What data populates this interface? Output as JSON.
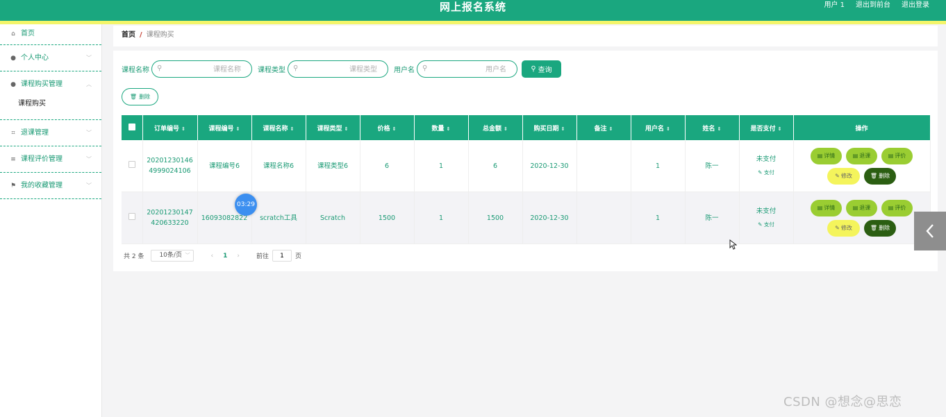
{
  "header": {
    "title": "网上报名系统",
    "links": [
      "用户 1",
      "退出到前台",
      "退出登录"
    ]
  },
  "sidebar": {
    "items": [
      {
        "label": "首页",
        "icon": "home-icon"
      },
      {
        "label": "个人中心",
        "icon": "user-icon"
      },
      {
        "label": "课程购买管理",
        "icon": "user-icon",
        "expanded": true
      },
      {
        "label": "课程购买",
        "sub": true
      },
      {
        "label": "退课管理",
        "icon": "crop-icon"
      },
      {
        "label": "课程评价管理",
        "icon": "list-icon"
      },
      {
        "label": "我的收藏管理",
        "icon": "flag-icon"
      }
    ]
  },
  "breadcrumb": {
    "home": "首页",
    "separator": "/",
    "current": "课程购买"
  },
  "filters": {
    "course_name": {
      "label": "课程名称",
      "placeholder": "课程名称"
    },
    "course_type": {
      "label": "课程类型",
      "placeholder": "课程类型"
    },
    "username": {
      "label": "用户名",
      "placeholder": "用户名"
    },
    "query_label": "查询",
    "batch_delete_label": "删除"
  },
  "table": {
    "columns": [
      "订单编号",
      "课程编号",
      "课程名称",
      "课程类型",
      "价格",
      "数量",
      "总金额",
      "购买日期",
      "备注",
      "用户名",
      "姓名",
      "是否支付",
      "操作"
    ],
    "rows": [
      {
        "order_no": "202012301464999024106",
        "course_no": "课程编号6",
        "course_name": "课程名称6",
        "course_type": "课程类型6",
        "price": "6",
        "qty": "1",
        "total": "6",
        "date": "2020-12-30",
        "note": "",
        "username": "1",
        "name": "陈一",
        "paid": "未支付",
        "pay_link": "支付"
      },
      {
        "order_no": "20201230147420633220",
        "course_no": "16093082822",
        "course_name": "scratch工具",
        "course_type": "Scratch",
        "price": "1500",
        "qty": "1",
        "total": "1500",
        "date": "2020-12-30",
        "note": "",
        "username": "1",
        "name": "陈一",
        "paid": "未支付",
        "pay_link": "支付"
      }
    ],
    "actions": {
      "detail": "详情",
      "withdraw": "退课",
      "review": "评价",
      "edit": "修改",
      "delete": "删除"
    }
  },
  "pagination": {
    "total_text": "共 2 条",
    "page_size": "10条/页",
    "current_page": "1",
    "goto_label": "前往",
    "goto_value": "1",
    "page_suffix": "页"
  },
  "overlay": {
    "timer": "03:29",
    "watermark": "CSDN @想念@思恋"
  },
  "colors": {
    "primary": "#1aa77f",
    "header_stripe": "#f3f56a",
    "btn_green": "#9acd32",
    "btn_yellow": "#f4f45c",
    "btn_dark": "#2b5e12",
    "timer_blue": "#3c8ff0"
  }
}
